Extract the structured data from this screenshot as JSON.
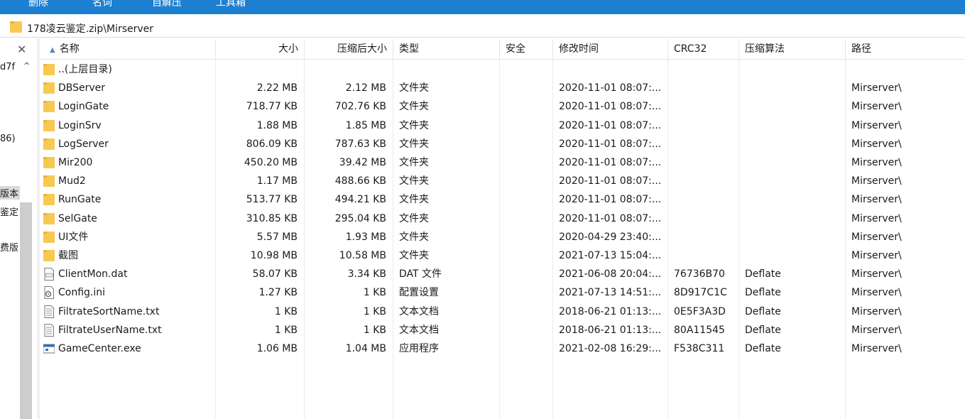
{
  "toolbar": {
    "items": [
      "删除",
      "名词",
      "自解压",
      "工具箱"
    ]
  },
  "address": {
    "path": "178凌云鉴定.zip\\Mirserver"
  },
  "tree": {
    "close": "✕",
    "items": [
      "d7f",
      "86)",
      "版本",
      "鉴定",
      "费版"
    ]
  },
  "columns": {
    "name": "名称",
    "size": "大小",
    "packed": "压缩后大小",
    "type": "类型",
    "security": "安全",
    "modified": "修改时间",
    "crc": "CRC32",
    "method": "压缩算法",
    "path": "路径"
  },
  "files": [
    {
      "name": "..(上层目录)",
      "size": "",
      "packed": "",
      "type": "",
      "modified": "",
      "crc": "",
      "method": "",
      "path": "",
      "icon": "folder-icon"
    },
    {
      "name": "DBServer",
      "size": "2.22 MB",
      "packed": "2.12 MB",
      "type": "文件夹",
      "modified": "2020-11-01 08:07:...",
      "crc": "",
      "method": "",
      "path": "Mirserver\\",
      "icon": "folder-icon"
    },
    {
      "name": "LoginGate",
      "size": "718.77 KB",
      "packed": "702.76 KB",
      "type": "文件夹",
      "modified": "2020-11-01 08:07:...",
      "crc": "",
      "method": "",
      "path": "Mirserver\\",
      "icon": "folder-icon"
    },
    {
      "name": "LoginSrv",
      "size": "1.88 MB",
      "packed": "1.85 MB",
      "type": "文件夹",
      "modified": "2020-11-01 08:07:...",
      "crc": "",
      "method": "",
      "path": "Mirserver\\",
      "icon": "folder-icon"
    },
    {
      "name": "LogServer",
      "size": "806.09 KB",
      "packed": "787.63 KB",
      "type": "文件夹",
      "modified": "2020-11-01 08:07:...",
      "crc": "",
      "method": "",
      "path": "Mirserver\\",
      "icon": "folder-icon"
    },
    {
      "name": "Mir200",
      "size": "450.20 MB",
      "packed": "39.42 MB",
      "type": "文件夹",
      "modified": "2020-11-01 08:07:...",
      "crc": "",
      "method": "",
      "path": "Mirserver\\",
      "icon": "folder-icon"
    },
    {
      "name": "Mud2",
      "size": "1.17 MB",
      "packed": "488.66 KB",
      "type": "文件夹",
      "modified": "2020-11-01 08:07:...",
      "crc": "",
      "method": "",
      "path": "Mirserver\\",
      "icon": "folder-icon"
    },
    {
      "name": "RunGate",
      "size": "513.77 KB",
      "packed": "494.21 KB",
      "type": "文件夹",
      "modified": "2020-11-01 08:07:...",
      "crc": "",
      "method": "",
      "path": "Mirserver\\",
      "icon": "folder-icon"
    },
    {
      "name": "SelGate",
      "size": "310.85 KB",
      "packed": "295.04 KB",
      "type": "文件夹",
      "modified": "2020-11-01 08:07:...",
      "crc": "",
      "method": "",
      "path": "Mirserver\\",
      "icon": "folder-icon"
    },
    {
      "name": "UI文件",
      "size": "5.57 MB",
      "packed": "1.93 MB",
      "type": "文件夹",
      "modified": "2020-04-29 23:40:...",
      "crc": "",
      "method": "",
      "path": "Mirserver\\",
      "icon": "folder-icon"
    },
    {
      "name": "截图",
      "size": "10.98 MB",
      "packed": "10.58 MB",
      "type": "文件夹",
      "modified": "2021-07-13 15:04:...",
      "crc": "",
      "method": "",
      "path": "Mirserver\\",
      "icon": "folder-icon"
    },
    {
      "name": "ClientMon.dat",
      "size": "58.07 KB",
      "packed": "3.34 KB",
      "type": "DAT 文件",
      "modified": "2021-06-08 20:04:...",
      "crc": "76736B70",
      "method": "Deflate",
      "path": "Mirserver\\",
      "icon": "dat-file-icon"
    },
    {
      "name": "Config.ini",
      "size": "1.27 KB",
      "packed": "1 KB",
      "type": "配置设置",
      "modified": "2021-07-13 14:51:...",
      "crc": "8D917C1C",
      "method": "Deflate",
      "path": "Mirserver\\",
      "icon": "ini-file-icon"
    },
    {
      "name": "FiltrateSortName.txt",
      "size": "1 KB",
      "packed": "1 KB",
      "type": "文本文档",
      "modified": "2018-06-21 01:13:...",
      "crc": "0E5F3A3D",
      "method": "Deflate",
      "path": "Mirserver\\",
      "icon": "text-file-icon"
    },
    {
      "name": "FiltrateUserName.txt",
      "size": "1 KB",
      "packed": "1 KB",
      "type": "文本文档",
      "modified": "2018-06-21 01:13:...",
      "crc": "80A11545",
      "method": "Deflate",
      "path": "Mirserver\\",
      "icon": "text-file-icon"
    },
    {
      "name": "GameCenter.exe",
      "size": "1.06 MB",
      "packed": "1.04 MB",
      "type": "应用程序",
      "modified": "2021-02-08 16:29:...",
      "crc": "F538C311",
      "method": "Deflate",
      "path": "Mirserver\\",
      "icon": "exe-file-icon"
    }
  ],
  "colors": {
    "toolbar": "#1d7fd0",
    "folder": "#f8c950",
    "sort_arrow": "#5a86c2"
  }
}
